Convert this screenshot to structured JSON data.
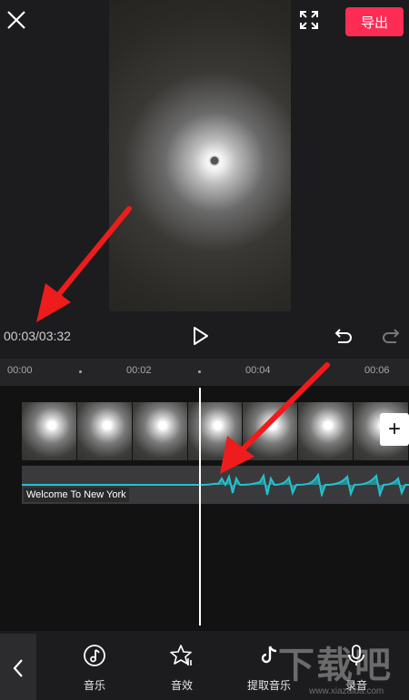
{
  "header": {
    "export_label": "导出"
  },
  "player": {
    "timecode": "00:03/03:32"
  },
  "ruler": {
    "ticks": [
      "00:00",
      "00:02",
      "00:04",
      "00:06"
    ]
  },
  "audio": {
    "track_name": "Welcome To New York"
  },
  "toolbar": {
    "items": [
      {
        "label": "音乐",
        "icon": "music-icon"
      },
      {
        "label": "音效",
        "icon": "sound-effect-icon"
      },
      {
        "label": "提取音乐",
        "icon": "extract-music-icon"
      },
      {
        "label": "录音",
        "icon": "record-icon"
      }
    ]
  },
  "watermark": {
    "text": "下载吧",
    "url": "www.xiazaiba.com"
  },
  "colors": {
    "accent": "#fd2c55",
    "waveform": "#25c1cf",
    "arrow": "#ee1c1c"
  }
}
